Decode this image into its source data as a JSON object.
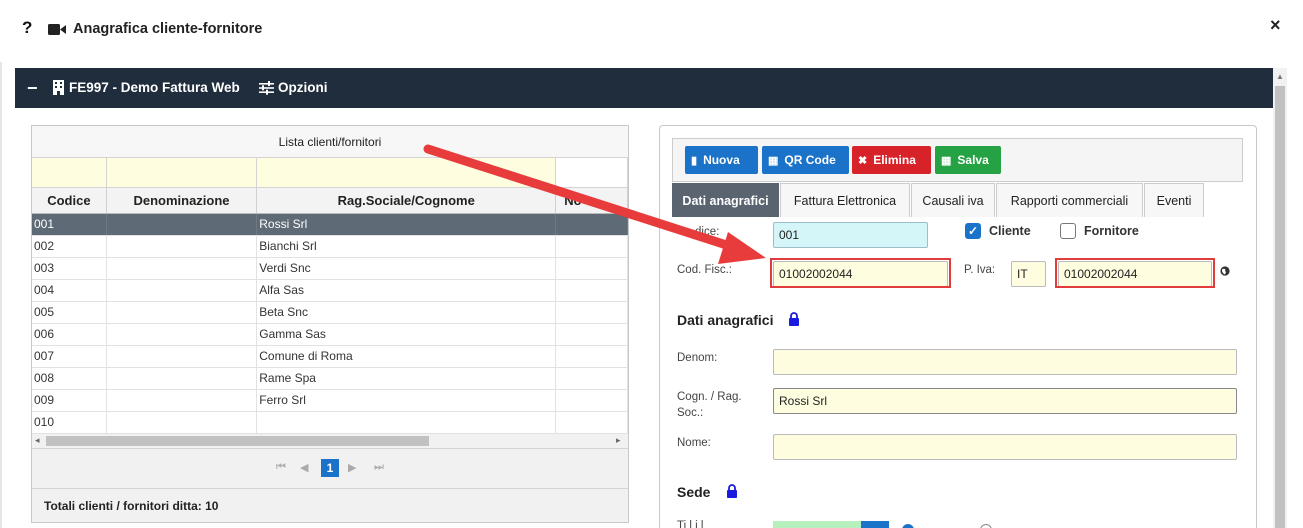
{
  "dialog": {
    "help": "?",
    "title": "Anagrafica cliente-fornitore",
    "close": "×"
  },
  "bar": {
    "minus": "−",
    "company": "FE997 - Demo Fattura Web",
    "options": "Opzioni"
  },
  "grid": {
    "caption": "Lista clienti/fornitori",
    "columns": [
      "Codice",
      "Denominazione",
      "Rag.Sociale/Cognome",
      "No"
    ],
    "rows": [
      {
        "codice": "001",
        "denominazione": "",
        "ragsoc": "Rossi Srl",
        "selected": true
      },
      {
        "codice": "002",
        "denominazione": "",
        "ragsoc": "Bianchi Srl"
      },
      {
        "codice": "003",
        "denominazione": "",
        "ragsoc": "Verdi Snc"
      },
      {
        "codice": "004",
        "denominazione": "",
        "ragsoc": "Alfa Sas"
      },
      {
        "codice": "005",
        "denominazione": "",
        "ragsoc": "Beta Snc"
      },
      {
        "codice": "006",
        "denominazione": "",
        "ragsoc": "Gamma Sas"
      },
      {
        "codice": "007",
        "denominazione": "",
        "ragsoc": "Comune di Roma"
      },
      {
        "codice": "008",
        "denominazione": "",
        "ragsoc": "Rame Spa"
      },
      {
        "codice": "009",
        "denominazione": "",
        "ragsoc": "Ferro Srl"
      },
      {
        "codice": "010",
        "denominazione": "",
        "ragsoc": ""
      }
    ],
    "pager": {
      "first": "⏮",
      "prev": "◀",
      "current": "1",
      "next": "▶",
      "last": "⏭"
    },
    "totals": "Totali clienti / fornitori ditta: 10"
  },
  "toolbar": {
    "nuova": "Nuova",
    "qr": "QR Code",
    "elimina": "Elimina",
    "salva": "Salva"
  },
  "tabs": [
    "Dati anagrafici",
    "Fattura Elettronica",
    "Causali iva",
    "Rapporti commerciali",
    "Eventi"
  ],
  "form": {
    "codice_label": "dice:",
    "codice_value": "001",
    "cliente_label": "Cliente",
    "cliente_checked": true,
    "fornitore_label": "Fornitore",
    "fornitore_checked": false,
    "codfisc_label": "Cod. Fisc.:",
    "codfisc_value": "01002002044",
    "piva_label": "P. Iva:",
    "piva_country": "IT",
    "piva_value": "01002002044",
    "section_anagrafici": "Dati anagrafici",
    "denom_label": "Denom:",
    "denom_value": "",
    "cognome_label_1": "Cogn. / Rag.",
    "cognome_label_2": "Soc.:",
    "cognome_value": "Rossi Srl",
    "nome_label": "Nome:",
    "nome_value": "",
    "section_sede": "Sede",
    "partial_label": "Ti    l  i     l"
  },
  "colors": {
    "dark_bar": "#1f2d3d",
    "primary": "#1a73c8",
    "danger": "#d8222a",
    "success": "#25a244",
    "highlight": "#e03c3c",
    "filter_yellow": "#fffde0"
  }
}
